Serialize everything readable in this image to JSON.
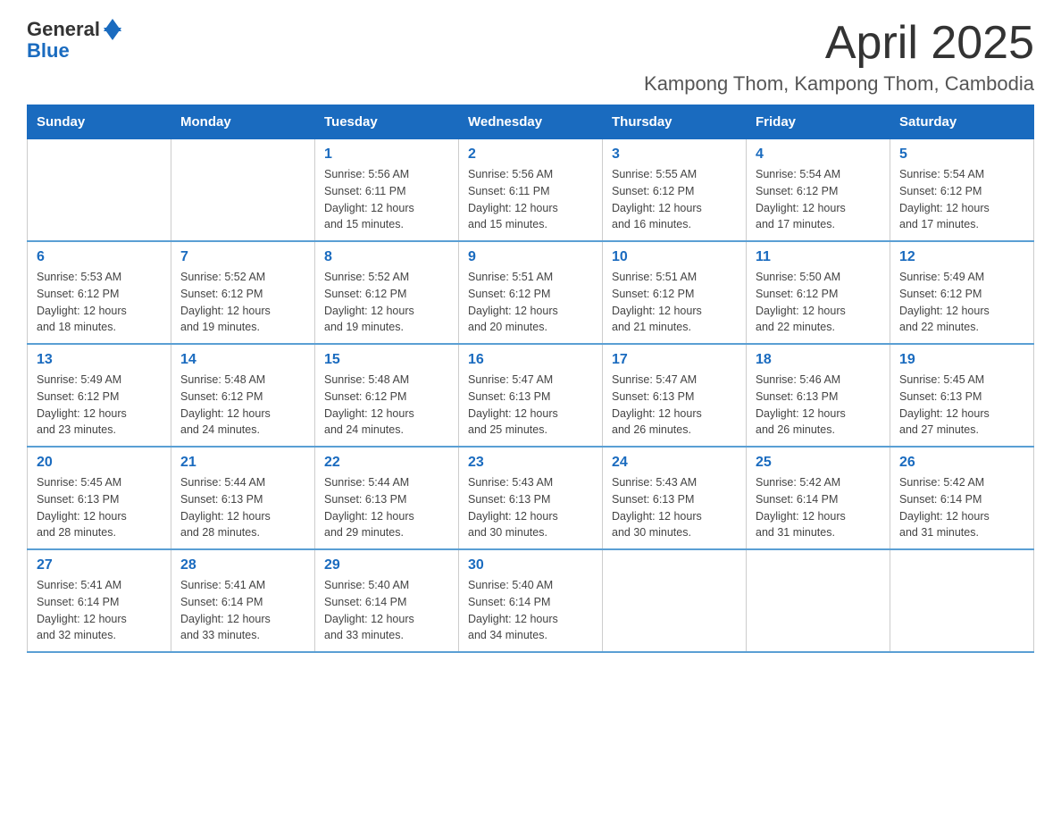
{
  "logo": {
    "general": "General",
    "blue": "Blue"
  },
  "title": {
    "month": "April 2025",
    "location": "Kampong Thom, Kampong Thom, Cambodia"
  },
  "weekdays": [
    "Sunday",
    "Monday",
    "Tuesday",
    "Wednesday",
    "Thursday",
    "Friday",
    "Saturday"
  ],
  "weeks": [
    [
      {
        "day": "",
        "info": ""
      },
      {
        "day": "",
        "info": ""
      },
      {
        "day": "1",
        "info": "Sunrise: 5:56 AM\nSunset: 6:11 PM\nDaylight: 12 hours\nand 15 minutes."
      },
      {
        "day": "2",
        "info": "Sunrise: 5:56 AM\nSunset: 6:11 PM\nDaylight: 12 hours\nand 15 minutes."
      },
      {
        "day": "3",
        "info": "Sunrise: 5:55 AM\nSunset: 6:12 PM\nDaylight: 12 hours\nand 16 minutes."
      },
      {
        "day": "4",
        "info": "Sunrise: 5:54 AM\nSunset: 6:12 PM\nDaylight: 12 hours\nand 17 minutes."
      },
      {
        "day": "5",
        "info": "Sunrise: 5:54 AM\nSunset: 6:12 PM\nDaylight: 12 hours\nand 17 minutes."
      }
    ],
    [
      {
        "day": "6",
        "info": "Sunrise: 5:53 AM\nSunset: 6:12 PM\nDaylight: 12 hours\nand 18 minutes."
      },
      {
        "day": "7",
        "info": "Sunrise: 5:52 AM\nSunset: 6:12 PM\nDaylight: 12 hours\nand 19 minutes."
      },
      {
        "day": "8",
        "info": "Sunrise: 5:52 AM\nSunset: 6:12 PM\nDaylight: 12 hours\nand 19 minutes."
      },
      {
        "day": "9",
        "info": "Sunrise: 5:51 AM\nSunset: 6:12 PM\nDaylight: 12 hours\nand 20 minutes."
      },
      {
        "day": "10",
        "info": "Sunrise: 5:51 AM\nSunset: 6:12 PM\nDaylight: 12 hours\nand 21 minutes."
      },
      {
        "day": "11",
        "info": "Sunrise: 5:50 AM\nSunset: 6:12 PM\nDaylight: 12 hours\nand 22 minutes."
      },
      {
        "day": "12",
        "info": "Sunrise: 5:49 AM\nSunset: 6:12 PM\nDaylight: 12 hours\nand 22 minutes."
      }
    ],
    [
      {
        "day": "13",
        "info": "Sunrise: 5:49 AM\nSunset: 6:12 PM\nDaylight: 12 hours\nand 23 minutes."
      },
      {
        "day": "14",
        "info": "Sunrise: 5:48 AM\nSunset: 6:12 PM\nDaylight: 12 hours\nand 24 minutes."
      },
      {
        "day": "15",
        "info": "Sunrise: 5:48 AM\nSunset: 6:12 PM\nDaylight: 12 hours\nand 24 minutes."
      },
      {
        "day": "16",
        "info": "Sunrise: 5:47 AM\nSunset: 6:13 PM\nDaylight: 12 hours\nand 25 minutes."
      },
      {
        "day": "17",
        "info": "Sunrise: 5:47 AM\nSunset: 6:13 PM\nDaylight: 12 hours\nand 26 minutes."
      },
      {
        "day": "18",
        "info": "Sunrise: 5:46 AM\nSunset: 6:13 PM\nDaylight: 12 hours\nand 26 minutes."
      },
      {
        "day": "19",
        "info": "Sunrise: 5:45 AM\nSunset: 6:13 PM\nDaylight: 12 hours\nand 27 minutes."
      }
    ],
    [
      {
        "day": "20",
        "info": "Sunrise: 5:45 AM\nSunset: 6:13 PM\nDaylight: 12 hours\nand 28 minutes."
      },
      {
        "day": "21",
        "info": "Sunrise: 5:44 AM\nSunset: 6:13 PM\nDaylight: 12 hours\nand 28 minutes."
      },
      {
        "day": "22",
        "info": "Sunrise: 5:44 AM\nSunset: 6:13 PM\nDaylight: 12 hours\nand 29 minutes."
      },
      {
        "day": "23",
        "info": "Sunrise: 5:43 AM\nSunset: 6:13 PM\nDaylight: 12 hours\nand 30 minutes."
      },
      {
        "day": "24",
        "info": "Sunrise: 5:43 AM\nSunset: 6:13 PM\nDaylight: 12 hours\nand 30 minutes."
      },
      {
        "day": "25",
        "info": "Sunrise: 5:42 AM\nSunset: 6:14 PM\nDaylight: 12 hours\nand 31 minutes."
      },
      {
        "day": "26",
        "info": "Sunrise: 5:42 AM\nSunset: 6:14 PM\nDaylight: 12 hours\nand 31 minutes."
      }
    ],
    [
      {
        "day": "27",
        "info": "Sunrise: 5:41 AM\nSunset: 6:14 PM\nDaylight: 12 hours\nand 32 minutes."
      },
      {
        "day": "28",
        "info": "Sunrise: 5:41 AM\nSunset: 6:14 PM\nDaylight: 12 hours\nand 33 minutes."
      },
      {
        "day": "29",
        "info": "Sunrise: 5:40 AM\nSunset: 6:14 PM\nDaylight: 12 hours\nand 33 minutes."
      },
      {
        "day": "30",
        "info": "Sunrise: 5:40 AM\nSunset: 6:14 PM\nDaylight: 12 hours\nand 34 minutes."
      },
      {
        "day": "",
        "info": ""
      },
      {
        "day": "",
        "info": ""
      },
      {
        "day": "",
        "info": ""
      }
    ]
  ]
}
